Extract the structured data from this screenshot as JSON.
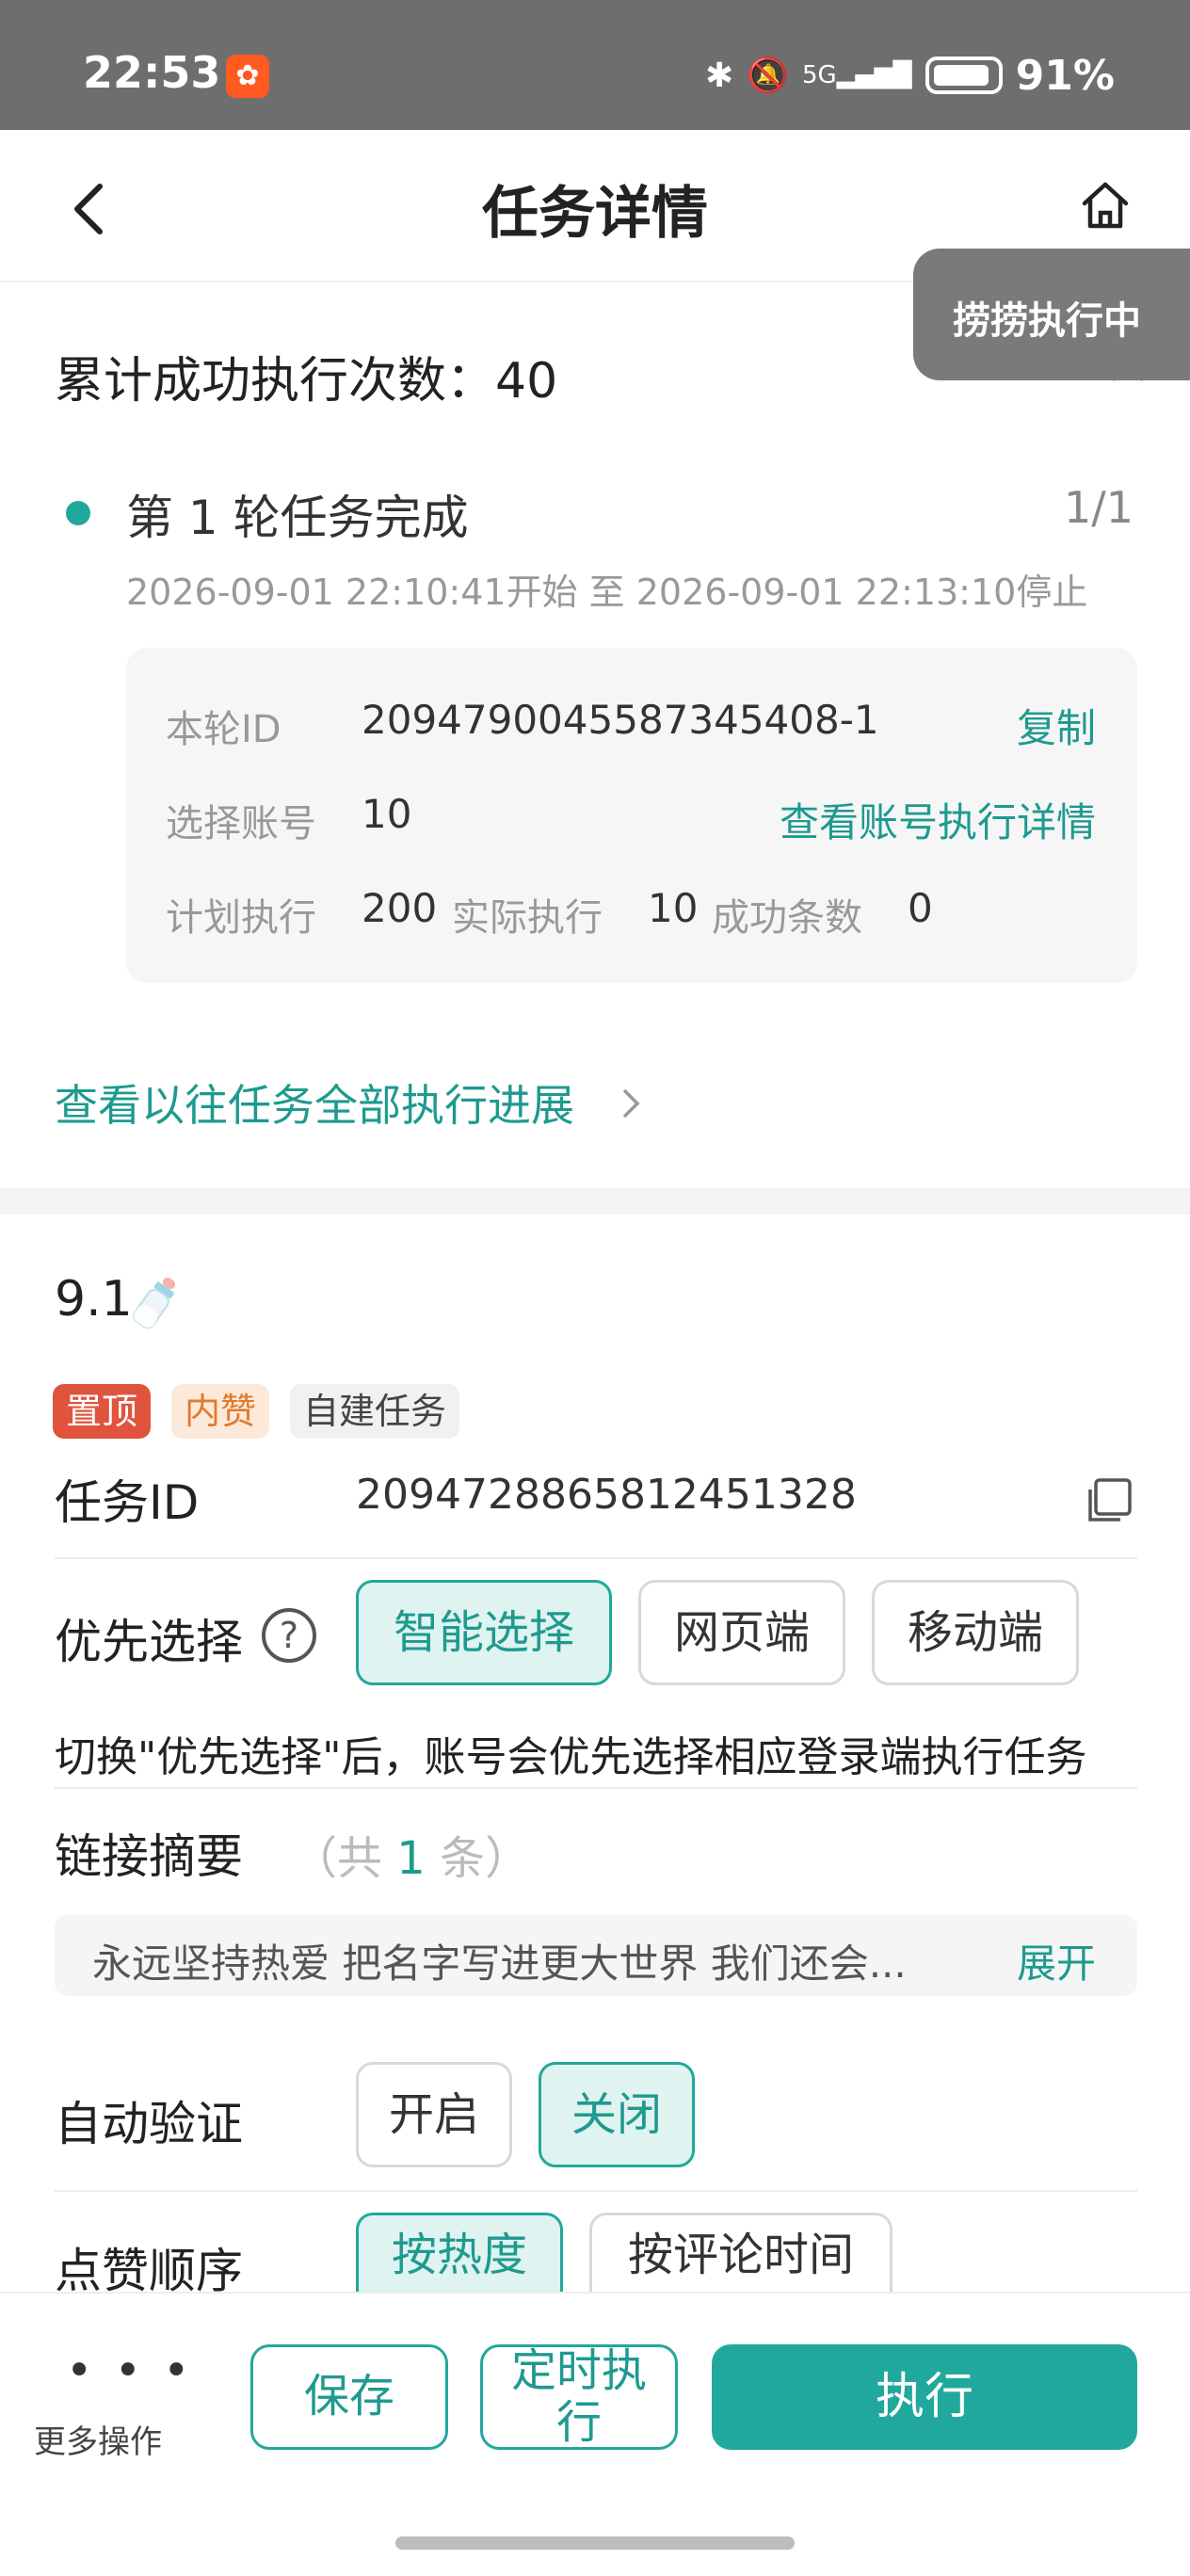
{
  "status_bar": {
    "time": "22:53",
    "network": "5G",
    "battery": "91%"
  },
  "header": {
    "title": "任务详情"
  },
  "toast": {
    "text": "捞捞执行中"
  },
  "summary": {
    "label": "累计成功执行次数：",
    "value": "40"
  },
  "round": {
    "title": "第 1 轮任务完成",
    "progress": "1/1",
    "time_range": "2026-09-01 22:10:41开始 至 2026-09-01 22:13:10停止",
    "round_id_label": "本轮ID",
    "round_id": "2094790045587345408-1",
    "copy_label": "复制",
    "accounts_label": "选择账号",
    "accounts_value": "10",
    "accounts_link": "查看账号执行详情",
    "planned_label": "计划执行",
    "planned_value": "200",
    "actual_label": "实际执行",
    "actual_value": "10",
    "success_label": "成功条数",
    "success_value": "0"
  },
  "history_link": "查看以往任务全部执行进展",
  "task": {
    "name": "9.1",
    "tags": {
      "top": "置顶",
      "inner_like": "内赞",
      "self_built": "自建任务"
    },
    "id_label": "任务ID",
    "id_value": "2094728865812451328",
    "priority_label": "优先选择",
    "priority_options": [
      "智能选择",
      "网页端",
      "移动端"
    ],
    "priority_selected": "智能选择",
    "priority_hint": "切换\"优先选择\"后，账号会优先选择相应登录端执行任务",
    "links_label": "链接摘要",
    "links_count_prefix": "（共 ",
    "links_count": "1",
    "links_count_suffix": " 条）",
    "link_summary": "永远坚持热爱 把名字写进更大世界 我们还会...",
    "expand_label": "展开",
    "auto_verify_label": "自动验证",
    "auto_verify_options": [
      "开启",
      "关闭"
    ],
    "auto_verify_selected": "关闭",
    "like_order_label": "点赞顺序",
    "like_order_options": [
      "按热度",
      "按评论时间"
    ],
    "like_order_selected": "按热度"
  },
  "bottom": {
    "more_label": "更多操作",
    "save": "保存",
    "schedule_line1": "定时执",
    "schedule_line2": "行",
    "execute": "执行"
  },
  "colors": {
    "accent": "#21a89c",
    "status_bar": "#6e6e6e",
    "tag_top": "#e0533d",
    "tag_like_text": "#e27a2e"
  }
}
